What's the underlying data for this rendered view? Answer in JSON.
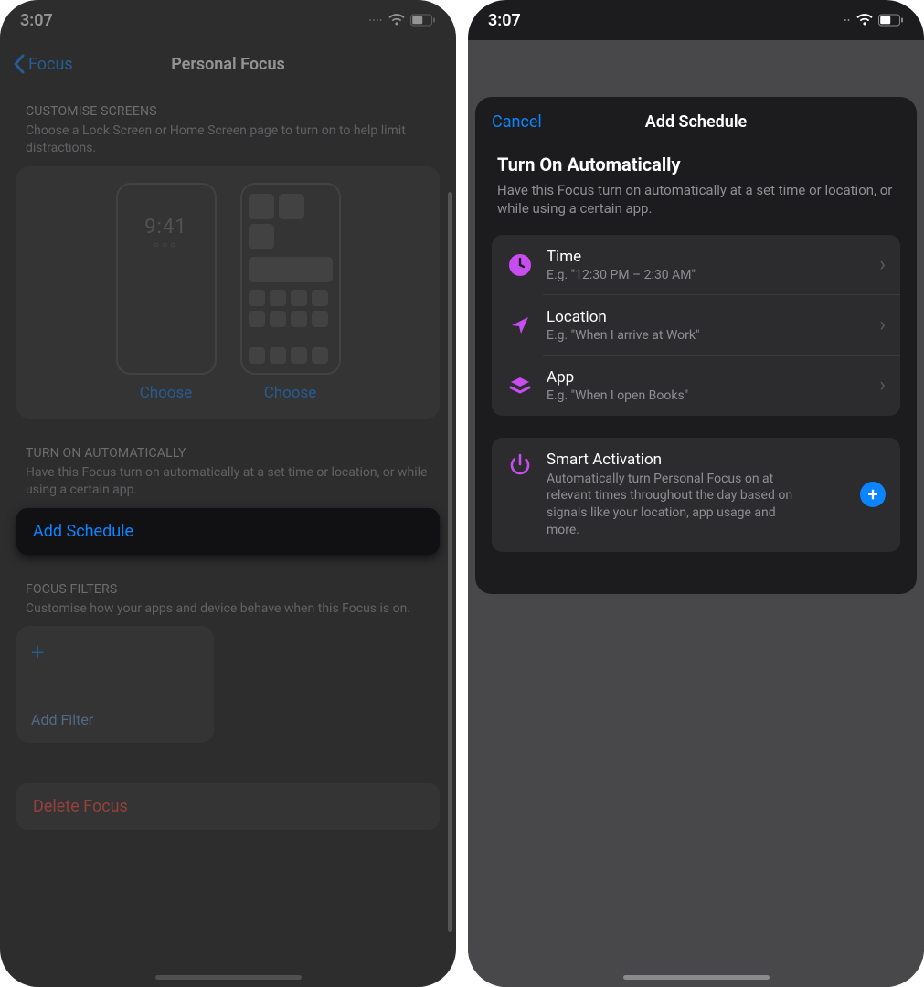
{
  "status": {
    "time": "3:07"
  },
  "left": {
    "back_label": "Focus",
    "title": "Personal Focus",
    "customise": {
      "header": "CUSTOMISE SCREENS",
      "sub": "Choose a Lock Screen or Home Screen page to turn on to help limit distractions.",
      "choose": "Choose",
      "lock_time": "9:41"
    },
    "auto": {
      "header": "TURN ON AUTOMATICALLY",
      "sub": "Have this Focus turn on automatically at a set time or location, or while using a certain app.",
      "add_schedule": "Add Schedule"
    },
    "filters": {
      "header": "FOCUS FILTERS",
      "sub": "Customise how your apps and device behave when this Focus is on.",
      "add_filter": "Add Filter"
    },
    "delete": "Delete Focus"
  },
  "right": {
    "cancel": "Cancel",
    "title": "Add Schedule",
    "section_title": "Turn On Automatically",
    "section_sub": "Have this Focus turn on automatically at a set time or location, or while using a certain app.",
    "rows": [
      {
        "title": "Time",
        "sub": "E.g. \"12:30 PM – 2:30 AM\""
      },
      {
        "title": "Location",
        "sub": "E.g. \"When I arrive at Work\""
      },
      {
        "title": "App",
        "sub": "E.g. \"When I open Books\""
      }
    ],
    "smart": {
      "title": "Smart Activation",
      "sub": "Automatically turn Personal Focus on at relevant times throughout the day based on signals like your location, app usage and more."
    }
  },
  "colors": {
    "accent_blue": "#0a84ff",
    "accent_magenta": "#c84df0",
    "danger": "#ff453a"
  }
}
